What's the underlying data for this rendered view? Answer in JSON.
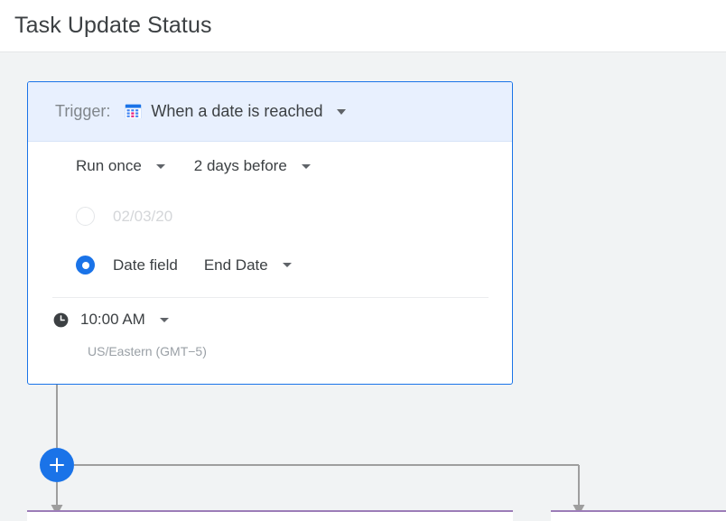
{
  "header": {
    "title": "Task Update Status"
  },
  "trigger_card": {
    "header": {
      "label": "Trigger:",
      "icon": "calendar-icon",
      "value": "When a date is reached",
      "caret": "chevron-down-icon"
    },
    "schedule": {
      "frequency": "Run once",
      "frequency_caret": "chevron-down-icon",
      "offset": "2 days before",
      "offset_caret": "chevron-down-icon"
    },
    "date_option": {
      "selected": false,
      "value": "02/03/20"
    },
    "date_field_option": {
      "selected": true,
      "label": "Date field",
      "value": "End Date",
      "caret": "chevron-down-icon"
    },
    "time": {
      "icon": "clock-icon",
      "value": "10:00 AM",
      "caret": "chevron-down-icon",
      "timezone": "US/Eastern (GMT−5)"
    }
  },
  "flow": {
    "add_step_button": {
      "icon": "plus-icon",
      "label": "+"
    }
  },
  "colors": {
    "accent_blue": "#1a73e8",
    "header_blue": "#e8f0fe",
    "canvas_gray": "#f1f3f4",
    "connector_gray": "#9e9e9e",
    "action_card_purple": "#9c7cb8",
    "text_primary": "#3c4043",
    "text_muted": "#80868b",
    "text_disabled": "#d4d6d9"
  }
}
